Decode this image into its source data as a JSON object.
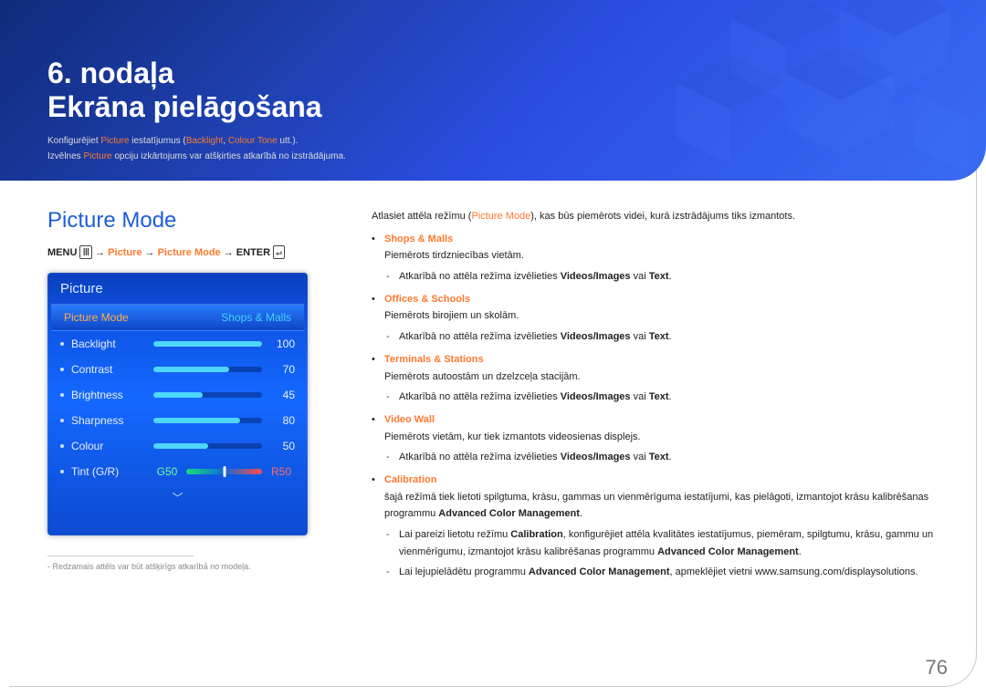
{
  "banner": {
    "chapter": "6. nodaļa",
    "title": "Ekrāna pielāgošana",
    "line1_a": "Konfigurējiet ",
    "line1_b": "Picture",
    "line1_c": " iestatījumus (",
    "line1_d": "Backlight",
    "line1_e": ", ",
    "line1_f": "Colour Tone",
    "line1_g": " utt.).",
    "line2_a": "Izvēlnes ",
    "line2_b": "Picture",
    "line2_c": " opciju izkārtojums var atšķirties atkarībā no izstrādājuma."
  },
  "heading": "Picture Mode",
  "breadcrumb": {
    "menu": "MENU",
    "p1": "Picture",
    "p2": "Picture Mode",
    "enter": "ENTER"
  },
  "osd": {
    "title": "Picture",
    "head_left": "Picture Mode",
    "head_right": "Shops & Malls",
    "rows": [
      {
        "label": "Backlight",
        "value": "100",
        "fill": "100%"
      },
      {
        "label": "Contrast",
        "value": "70",
        "fill": "70%"
      },
      {
        "label": "Brightness",
        "value": "45",
        "fill": "45%"
      },
      {
        "label": "Sharpness",
        "value": "80",
        "fill": "80%"
      },
      {
        "label": "Colour",
        "value": "50",
        "fill": "50%"
      }
    ],
    "tint_label": "Tint (G/R)",
    "tint_g": "G50",
    "tint_r": "R50"
  },
  "footnote": "Redzamais attēls var būt atšķirīgs atkarībā no modeļa.",
  "right": {
    "intro_a": "Atlasiet attēla režīmu (",
    "intro_b": "Picture Mode",
    "intro_c": "), kas būs piemērots videi, kurā izstrādājums tiks izmantots.",
    "shops_title": "Shops & Malls",
    "shops_desc": "Piemērots tirdzniecības vietām.",
    "depend_a": "Atkarībā no attēla režīma izvēlieties ",
    "vi": "Videos/Images",
    "or": " vai ",
    "tx": "Text",
    "offices_title": "Offices & Schools",
    "offices_desc": "Piemērots birojiem un skolām.",
    "terminals_title": "Terminals & Stations",
    "terminals_desc": "Piemērots autoostām un dzelzceļa stacijām.",
    "videowall_title": "Video Wall",
    "videowall_desc": "Piemērots vietām, kur tiek izmantots videosienas displejs.",
    "calibration_title": "Calibration",
    "cal_line1_a": "šajā režīmā tiek lietoti spilgtuma, krāsu, gammas un vienmērīguma iestatījumi, kas pielāgoti, izmantojot krāsu kalibrēšanas programmu ",
    "acm": "Advanced Color Management",
    "cal_dash1_a": "Lai pareizi lietotu režīmu ",
    "cal_dash1_b": "Calibration",
    "cal_dash1_c": ", konfigurējiet attēla kvalitātes iestatījumus, piemēram, spilgtumu, krāsu, gammu un vienmērīgumu, izmantojot krāsu kalibrēšanas programmu ",
    "cal_dash2_a": "Lai lejupielādētu programmu ",
    "cal_dash2_b": ", apmeklējiet vietni www.samsung.com/displaysolutions."
  },
  "page_number": "76"
}
